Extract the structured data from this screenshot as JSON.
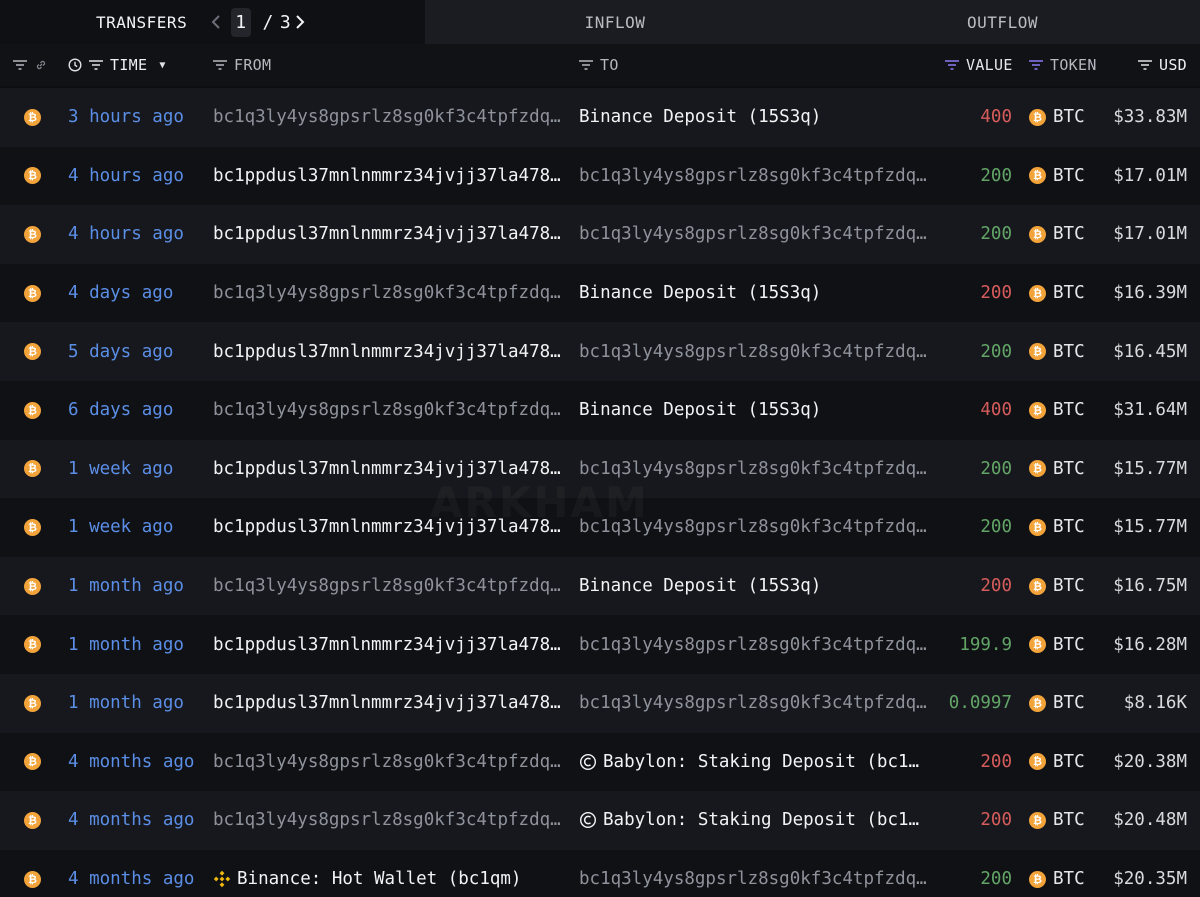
{
  "tabs": {
    "transfers": "TRANSFERS",
    "inflow": "INFLOW",
    "outflow": "OUTFLOW",
    "page_current": "1",
    "page_sep": "/",
    "page_total": "3"
  },
  "columns": {
    "time": "TIME",
    "from": "FROM",
    "to": "TO",
    "value": "VALUE",
    "token": "TOKEN",
    "usd": "USD"
  },
  "watermark": "ARKHAM",
  "colors": {
    "time_link": "#5b8ee6",
    "value_out": "#d65c5c",
    "value_in": "#62a567",
    "btc": "#f2a33a",
    "active_filter": "#8b7cf6"
  },
  "rows": [
    {
      "time": "3 hours ago",
      "from": "bc1q3ly4ys8gpsrlz8sg0kf3c4tpfzdq…",
      "from_style": "dim",
      "from_icon": "",
      "to": "Binance Deposit (15S3q)",
      "to_style": "white",
      "to_icon": "",
      "value": "400",
      "value_dir": "out",
      "token": "BTC",
      "usd": "$33.83M"
    },
    {
      "time": "4 hours ago",
      "from": "bc1ppdusl37mnlnmmrz34jvjj37la478…",
      "from_style": "white",
      "from_icon": "",
      "to": "bc1q3ly4ys8gpsrlz8sg0kf3c4tpfzdq…",
      "to_style": "dim",
      "to_icon": "",
      "value": "200",
      "value_dir": "in",
      "token": "BTC",
      "usd": "$17.01M"
    },
    {
      "time": "4 hours ago",
      "from": "bc1ppdusl37mnlnmmrz34jvjj37la478…",
      "from_style": "white",
      "from_icon": "",
      "to": "bc1q3ly4ys8gpsrlz8sg0kf3c4tpfzdq…",
      "to_style": "dim",
      "to_icon": "",
      "value": "200",
      "value_dir": "in",
      "token": "BTC",
      "usd": "$17.01M"
    },
    {
      "time": "4 days ago",
      "from": "bc1q3ly4ys8gpsrlz8sg0kf3c4tpfzdq…",
      "from_style": "dim",
      "from_icon": "",
      "to": "Binance Deposit (15S3q)",
      "to_style": "white",
      "to_icon": "",
      "value": "200",
      "value_dir": "out",
      "token": "BTC",
      "usd": "$16.39M"
    },
    {
      "time": "5 days ago",
      "from": "bc1ppdusl37mnlnmmrz34jvjj37la478…",
      "from_style": "white",
      "from_icon": "",
      "to": "bc1q3ly4ys8gpsrlz8sg0kf3c4tpfzdq…",
      "to_style": "dim",
      "to_icon": "",
      "value": "200",
      "value_dir": "in",
      "token": "BTC",
      "usd": "$16.45M"
    },
    {
      "time": "6 days ago",
      "from": "bc1q3ly4ys8gpsrlz8sg0kf3c4tpfzdq…",
      "from_style": "dim",
      "from_icon": "",
      "to": "Binance Deposit (15S3q)",
      "to_style": "white",
      "to_icon": "",
      "value": "400",
      "value_dir": "out",
      "token": "BTC",
      "usd": "$31.64M"
    },
    {
      "time": "1 week ago",
      "from": "bc1ppdusl37mnlnmmrz34jvjj37la478…",
      "from_style": "white",
      "from_icon": "",
      "to": "bc1q3ly4ys8gpsrlz8sg0kf3c4tpfzdq…",
      "to_style": "dim",
      "to_icon": "",
      "value": "200",
      "value_dir": "in",
      "token": "BTC",
      "usd": "$15.77M"
    },
    {
      "time": "1 week ago",
      "from": "bc1ppdusl37mnlnmmrz34jvjj37la478…",
      "from_style": "white",
      "from_icon": "",
      "to": "bc1q3ly4ys8gpsrlz8sg0kf3c4tpfzdq…",
      "to_style": "dim",
      "to_icon": "",
      "value": "200",
      "value_dir": "in",
      "token": "BTC",
      "usd": "$15.77M"
    },
    {
      "time": "1 month ago",
      "from": "bc1q3ly4ys8gpsrlz8sg0kf3c4tpfzdq…",
      "from_style": "dim",
      "from_icon": "",
      "to": "Binance Deposit (15S3q)",
      "to_style": "white",
      "to_icon": "",
      "value": "200",
      "value_dir": "out",
      "token": "BTC",
      "usd": "$16.75M"
    },
    {
      "time": "1 month ago",
      "from": "bc1ppdusl37mnlnmmrz34jvjj37la478…",
      "from_style": "white",
      "from_icon": "",
      "to": "bc1q3ly4ys8gpsrlz8sg0kf3c4tpfzdq…",
      "to_style": "dim",
      "to_icon": "",
      "value": "199.9",
      "value_dir": "in",
      "token": "BTC",
      "usd": "$16.28M"
    },
    {
      "time": "1 month ago",
      "from": "bc1ppdusl37mnlnmmrz34jvjj37la478…",
      "from_style": "white",
      "from_icon": "",
      "to": "bc1q3ly4ys8gpsrlz8sg0kf3c4tpfzdq…",
      "to_style": "dim",
      "to_icon": "",
      "value": "0.0997",
      "value_dir": "in",
      "token": "BTC",
      "usd": "$8.16K"
    },
    {
      "time": "4 months ago",
      "from": "bc1q3ly4ys8gpsrlz8sg0kf3c4tpfzdq…",
      "from_style": "dim",
      "from_icon": "",
      "to": "Babylon: Staking Deposit (bc1…",
      "to_style": "white",
      "to_icon": "babylon-icon",
      "value": "200",
      "value_dir": "out",
      "token": "BTC",
      "usd": "$20.38M"
    },
    {
      "time": "4 months ago",
      "from": "bc1q3ly4ys8gpsrlz8sg0kf3c4tpfzdq…",
      "from_style": "dim",
      "from_icon": "",
      "to": "Babylon: Staking Deposit (bc1…",
      "to_style": "white",
      "to_icon": "babylon-icon",
      "value": "200",
      "value_dir": "out",
      "token": "BTC",
      "usd": "$20.48M"
    },
    {
      "time": "4 months ago",
      "from": "Binance: Hot Wallet (bc1qm)",
      "from_style": "white",
      "from_icon": "binance-icon",
      "to": "bc1q3ly4ys8gpsrlz8sg0kf3c4tpfzdq…",
      "to_style": "dim",
      "to_icon": "",
      "value": "200",
      "value_dir": "in",
      "token": "BTC",
      "usd": "$20.35M"
    }
  ]
}
